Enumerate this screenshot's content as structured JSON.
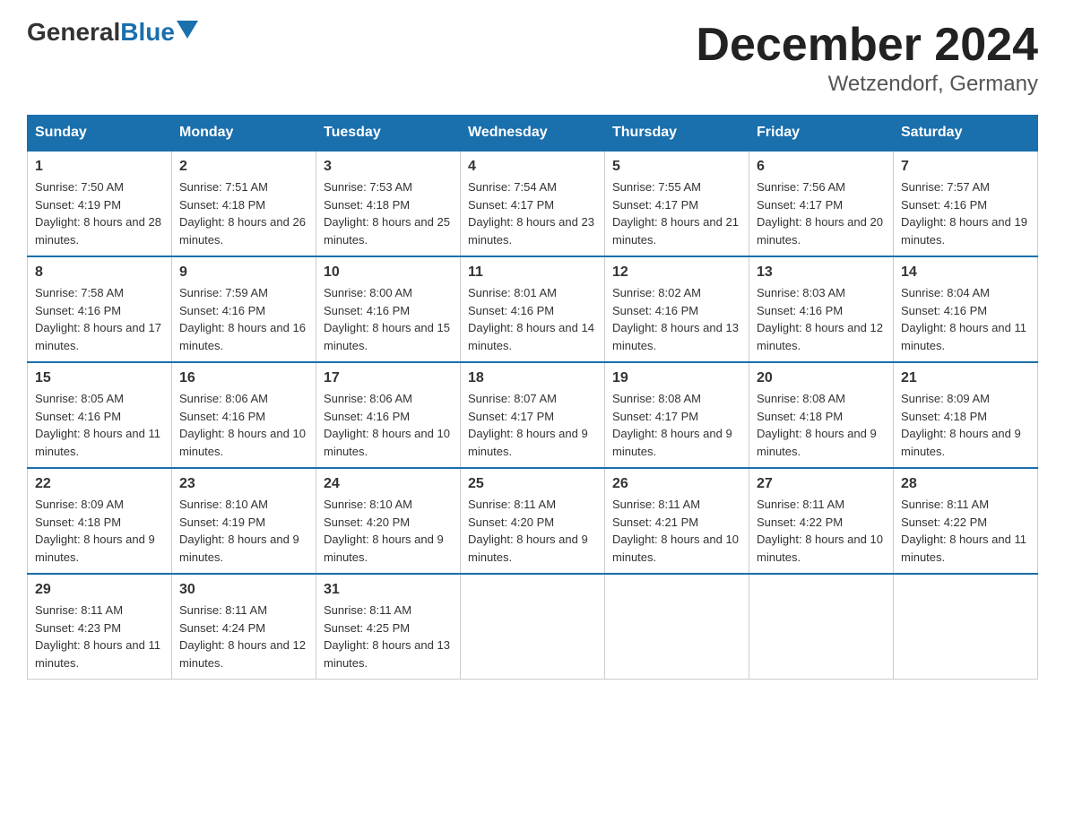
{
  "logo": {
    "general": "General",
    "blue": "Blue"
  },
  "title": "December 2024",
  "subtitle": "Wetzendorf, Germany",
  "days": [
    "Sunday",
    "Monday",
    "Tuesday",
    "Wednesday",
    "Thursday",
    "Friday",
    "Saturday"
  ],
  "weeks": [
    [
      {
        "day": "1",
        "sunrise": "7:50 AM",
        "sunset": "4:19 PM",
        "daylight": "8 hours and 28 minutes."
      },
      {
        "day": "2",
        "sunrise": "7:51 AM",
        "sunset": "4:18 PM",
        "daylight": "8 hours and 26 minutes."
      },
      {
        "day": "3",
        "sunrise": "7:53 AM",
        "sunset": "4:18 PM",
        "daylight": "8 hours and 25 minutes."
      },
      {
        "day": "4",
        "sunrise": "7:54 AM",
        "sunset": "4:17 PM",
        "daylight": "8 hours and 23 minutes."
      },
      {
        "day": "5",
        "sunrise": "7:55 AM",
        "sunset": "4:17 PM",
        "daylight": "8 hours and 21 minutes."
      },
      {
        "day": "6",
        "sunrise": "7:56 AM",
        "sunset": "4:17 PM",
        "daylight": "8 hours and 20 minutes."
      },
      {
        "day": "7",
        "sunrise": "7:57 AM",
        "sunset": "4:16 PM",
        "daylight": "8 hours and 19 minutes."
      }
    ],
    [
      {
        "day": "8",
        "sunrise": "7:58 AM",
        "sunset": "4:16 PM",
        "daylight": "8 hours and 17 minutes."
      },
      {
        "day": "9",
        "sunrise": "7:59 AM",
        "sunset": "4:16 PM",
        "daylight": "8 hours and 16 minutes."
      },
      {
        "day": "10",
        "sunrise": "8:00 AM",
        "sunset": "4:16 PM",
        "daylight": "8 hours and 15 minutes."
      },
      {
        "day": "11",
        "sunrise": "8:01 AM",
        "sunset": "4:16 PM",
        "daylight": "8 hours and 14 minutes."
      },
      {
        "day": "12",
        "sunrise": "8:02 AM",
        "sunset": "4:16 PM",
        "daylight": "8 hours and 13 minutes."
      },
      {
        "day": "13",
        "sunrise": "8:03 AM",
        "sunset": "4:16 PM",
        "daylight": "8 hours and 12 minutes."
      },
      {
        "day": "14",
        "sunrise": "8:04 AM",
        "sunset": "4:16 PM",
        "daylight": "8 hours and 11 minutes."
      }
    ],
    [
      {
        "day": "15",
        "sunrise": "8:05 AM",
        "sunset": "4:16 PM",
        "daylight": "8 hours and 11 minutes."
      },
      {
        "day": "16",
        "sunrise": "8:06 AM",
        "sunset": "4:16 PM",
        "daylight": "8 hours and 10 minutes."
      },
      {
        "day": "17",
        "sunrise": "8:06 AM",
        "sunset": "4:16 PM",
        "daylight": "8 hours and 10 minutes."
      },
      {
        "day": "18",
        "sunrise": "8:07 AM",
        "sunset": "4:17 PM",
        "daylight": "8 hours and 9 minutes."
      },
      {
        "day": "19",
        "sunrise": "8:08 AM",
        "sunset": "4:17 PM",
        "daylight": "8 hours and 9 minutes."
      },
      {
        "day": "20",
        "sunrise": "8:08 AM",
        "sunset": "4:18 PM",
        "daylight": "8 hours and 9 minutes."
      },
      {
        "day": "21",
        "sunrise": "8:09 AM",
        "sunset": "4:18 PM",
        "daylight": "8 hours and 9 minutes."
      }
    ],
    [
      {
        "day": "22",
        "sunrise": "8:09 AM",
        "sunset": "4:18 PM",
        "daylight": "8 hours and 9 minutes."
      },
      {
        "day": "23",
        "sunrise": "8:10 AM",
        "sunset": "4:19 PM",
        "daylight": "8 hours and 9 minutes."
      },
      {
        "day": "24",
        "sunrise": "8:10 AM",
        "sunset": "4:20 PM",
        "daylight": "8 hours and 9 minutes."
      },
      {
        "day": "25",
        "sunrise": "8:11 AM",
        "sunset": "4:20 PM",
        "daylight": "8 hours and 9 minutes."
      },
      {
        "day": "26",
        "sunrise": "8:11 AM",
        "sunset": "4:21 PM",
        "daylight": "8 hours and 10 minutes."
      },
      {
        "day": "27",
        "sunrise": "8:11 AM",
        "sunset": "4:22 PM",
        "daylight": "8 hours and 10 minutes."
      },
      {
        "day": "28",
        "sunrise": "8:11 AM",
        "sunset": "4:22 PM",
        "daylight": "8 hours and 11 minutes."
      }
    ],
    [
      {
        "day": "29",
        "sunrise": "8:11 AM",
        "sunset": "4:23 PM",
        "daylight": "8 hours and 11 minutes."
      },
      {
        "day": "30",
        "sunrise": "8:11 AM",
        "sunset": "4:24 PM",
        "daylight": "8 hours and 12 minutes."
      },
      {
        "day": "31",
        "sunrise": "8:11 AM",
        "sunset": "4:25 PM",
        "daylight": "8 hours and 13 minutes."
      },
      null,
      null,
      null,
      null
    ]
  ],
  "labels": {
    "sunrise_prefix": "Sunrise: ",
    "sunset_prefix": "Sunset: ",
    "daylight_prefix": "Daylight: "
  }
}
